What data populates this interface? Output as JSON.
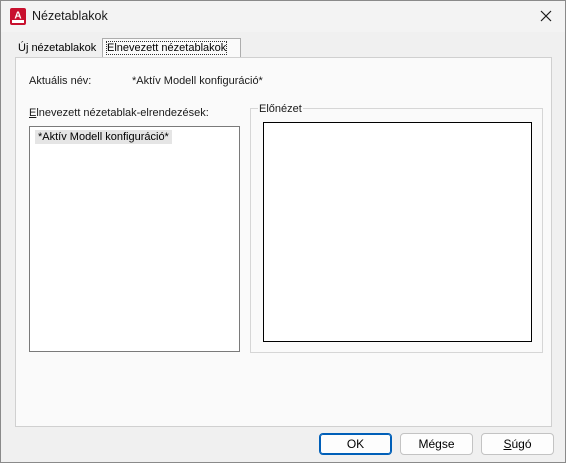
{
  "window": {
    "title": "Nézetablakok",
    "app_icon": "autocad-icon",
    "close_icon": "close-icon"
  },
  "tabs": [
    {
      "label": "Új nézetablakok",
      "active": false
    },
    {
      "label": "Elnevezett nézetablakok",
      "active": true
    }
  ],
  "current": {
    "label": "Aktuális név:",
    "value": "*Aktív Modell konfiguráció*"
  },
  "list": {
    "label": "Elnevezett nézetablak-elrendezések:",
    "items": [
      "*Aktív Modell konfiguráció*"
    ]
  },
  "preview": {
    "legend": "Előnézet"
  },
  "buttons": {
    "ok": "OK",
    "cancel": "Mégse",
    "help": "Súgó"
  },
  "colors": {
    "accent": "#005fb8",
    "app_icon_red": "#c8102e"
  }
}
